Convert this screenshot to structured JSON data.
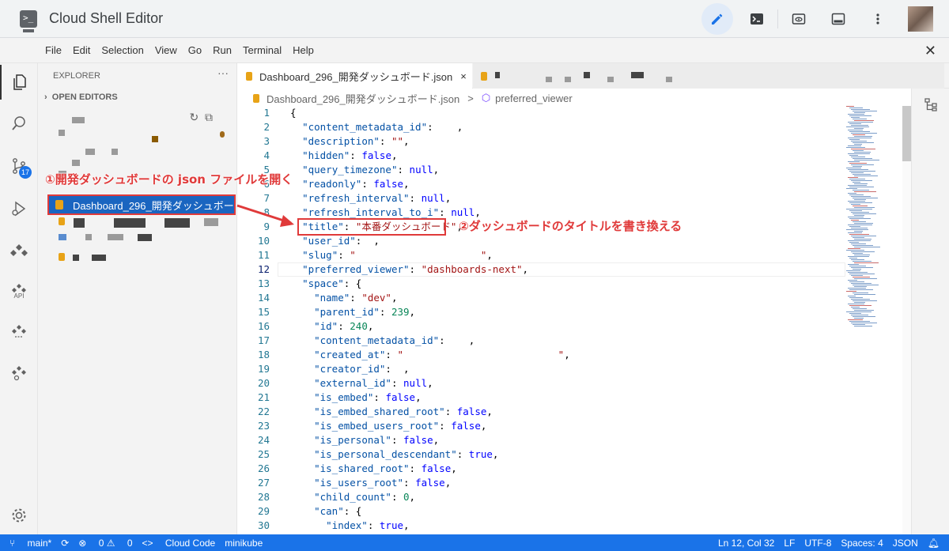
{
  "titlebar": {
    "app_title": "Cloud Shell Editor",
    "logo_glyph": ">_",
    "icons": [
      "pencil-icon",
      "terminal-icon",
      "preview-icon",
      "panel-icon",
      "more-vert-icon"
    ]
  },
  "menu": {
    "items": [
      "File",
      "Edit",
      "Selection",
      "View",
      "Go",
      "Run",
      "Terminal",
      "Help"
    ]
  },
  "activity": {
    "scm_badge": "17",
    "api_label": "API"
  },
  "sidebar": {
    "title": "EXPLORER",
    "more": "···",
    "section": "OPEN EDITORS",
    "selected_file": "Dashboard_296_開発ダッシュボー"
  },
  "tabs": {
    "active_tab": "Dashboard_296_開発ダッシュボード.json",
    "close_glyph": "×"
  },
  "breadcrumb": {
    "file": "Dashboard_296_開発ダッシュボード.json",
    "separator": ">",
    "symbol": "preferred_viewer"
  },
  "editor": {
    "current_line": 12,
    "lines": [
      {
        "n": "1",
        "t": "{"
      },
      {
        "n": "2",
        "t": "  \"content_metadata_id\":    ,"
      },
      {
        "n": "3",
        "t": "  \"description\": \"\","
      },
      {
        "n": "4",
        "t": "  \"hidden\": false,"
      },
      {
        "n": "5",
        "t": "  \"query_timezone\": null,"
      },
      {
        "n": "6",
        "t": "  \"readonly\": false,"
      },
      {
        "n": "7",
        "t": "  \"refresh_interval\": null,"
      },
      {
        "n": "8",
        "t": "  \"refresh_interval_to_i\": null,"
      },
      {
        "n": "9",
        "t": "  \"title\": \"本番ダッシュボード\","
      },
      {
        "n": "10",
        "t": "  \"user_id\":  ,"
      },
      {
        "n": "11",
        "t": "  \"slug\": \"                     \","
      },
      {
        "n": "12",
        "t": "  \"preferred_viewer\": \"dashboards-next\","
      },
      {
        "n": "13",
        "t": "  \"space\": {"
      },
      {
        "n": "14",
        "t": "    \"name\": \"dev\","
      },
      {
        "n": "15",
        "t": "    \"parent_id\": 239,"
      },
      {
        "n": "16",
        "t": "    \"id\": 240,"
      },
      {
        "n": "17",
        "t": "    \"content_metadata_id\":    ,"
      },
      {
        "n": "18",
        "t": "    \"created_at\": \"                          \","
      },
      {
        "n": "19",
        "t": "    \"creator_id\":  ,"
      },
      {
        "n": "20",
        "t": "    \"external_id\": null,"
      },
      {
        "n": "21",
        "t": "    \"is_embed\": false,"
      },
      {
        "n": "22",
        "t": "    \"is_embed_shared_root\": false,"
      },
      {
        "n": "23",
        "t": "    \"is_embed_users_root\": false,"
      },
      {
        "n": "24",
        "t": "    \"is_personal\": false,"
      },
      {
        "n": "25",
        "t": "    \"is_personal_descendant\": true,"
      },
      {
        "n": "26",
        "t": "    \"is_shared_root\": false,"
      },
      {
        "n": "27",
        "t": "    \"is_users_root\": false,"
      },
      {
        "n": "28",
        "t": "    \"child_count\": 0,"
      },
      {
        "n": "29",
        "t": "    \"can\": {"
      },
      {
        "n": "30",
        "t": "      \"index\": true,"
      }
    ]
  },
  "annotations": {
    "step1": "①開発ダッシュボードの json ファイルを開く",
    "step2": "②ダッシュボードのタイトルを書き換える"
  },
  "status": {
    "branch": "main*",
    "errors": "0",
    "warnings": "0",
    "cloud_code": "Cloud Code",
    "cluster": "minikube",
    "position": "Ln 12, Col 32",
    "eol": "LF",
    "encoding": "UTF-8",
    "indent": "Spaces: 4",
    "language": "JSON"
  },
  "colors": {
    "accent": "#1a73e8",
    "annotation": "#e03a3a"
  }
}
